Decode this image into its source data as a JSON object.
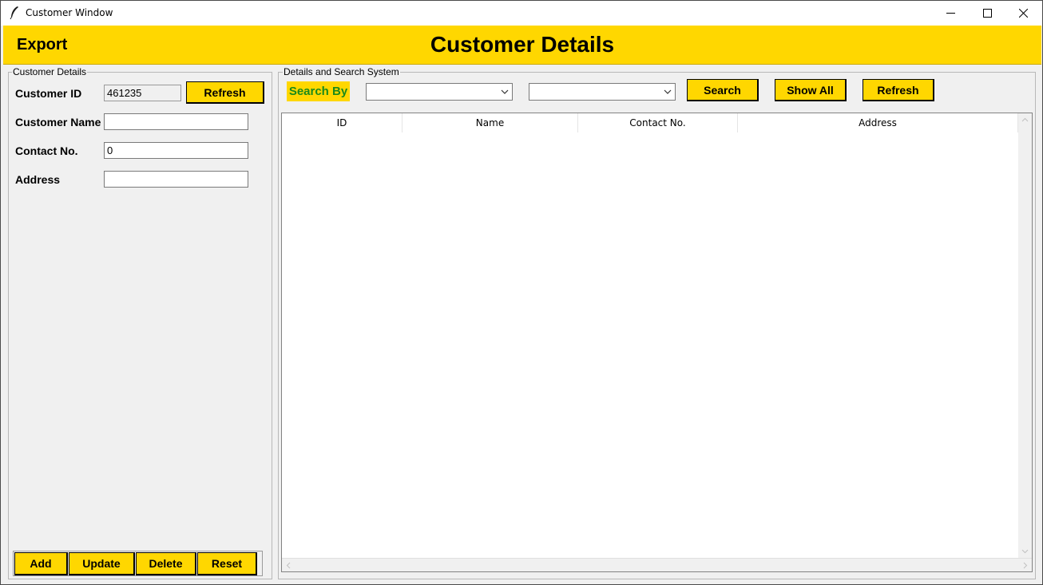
{
  "window": {
    "title": "Customer Window"
  },
  "header": {
    "export_label": "Export",
    "title": "Customer Details"
  },
  "left_panel": {
    "frame_title": "Customer Details",
    "customer_id": {
      "label": "Customer ID",
      "value": "461235"
    },
    "refresh_label": "Refresh",
    "customer_name": {
      "label": "Customer Name",
      "value": ""
    },
    "contact_no": {
      "label": "Contact No.",
      "value": "0"
    },
    "address": {
      "label": "Address",
      "value": ""
    },
    "buttons": {
      "add": "Add",
      "update": "Update",
      "delete": "Delete",
      "reset": "Reset"
    }
  },
  "right_panel": {
    "frame_title": "Details and Search System",
    "search_by_label": "Search By",
    "search_field_value": "",
    "search_text_value": "",
    "buttons": {
      "search": "Search",
      "show_all": "Show All",
      "refresh": "Refresh"
    },
    "table": {
      "columns": [
        "ID",
        "Name",
        "Contact No.",
        "Address"
      ],
      "rows": []
    }
  },
  "colors": {
    "accent": "#ffd700",
    "search_by_text": "#1a8a1a",
    "background": "#f0f0f0"
  }
}
